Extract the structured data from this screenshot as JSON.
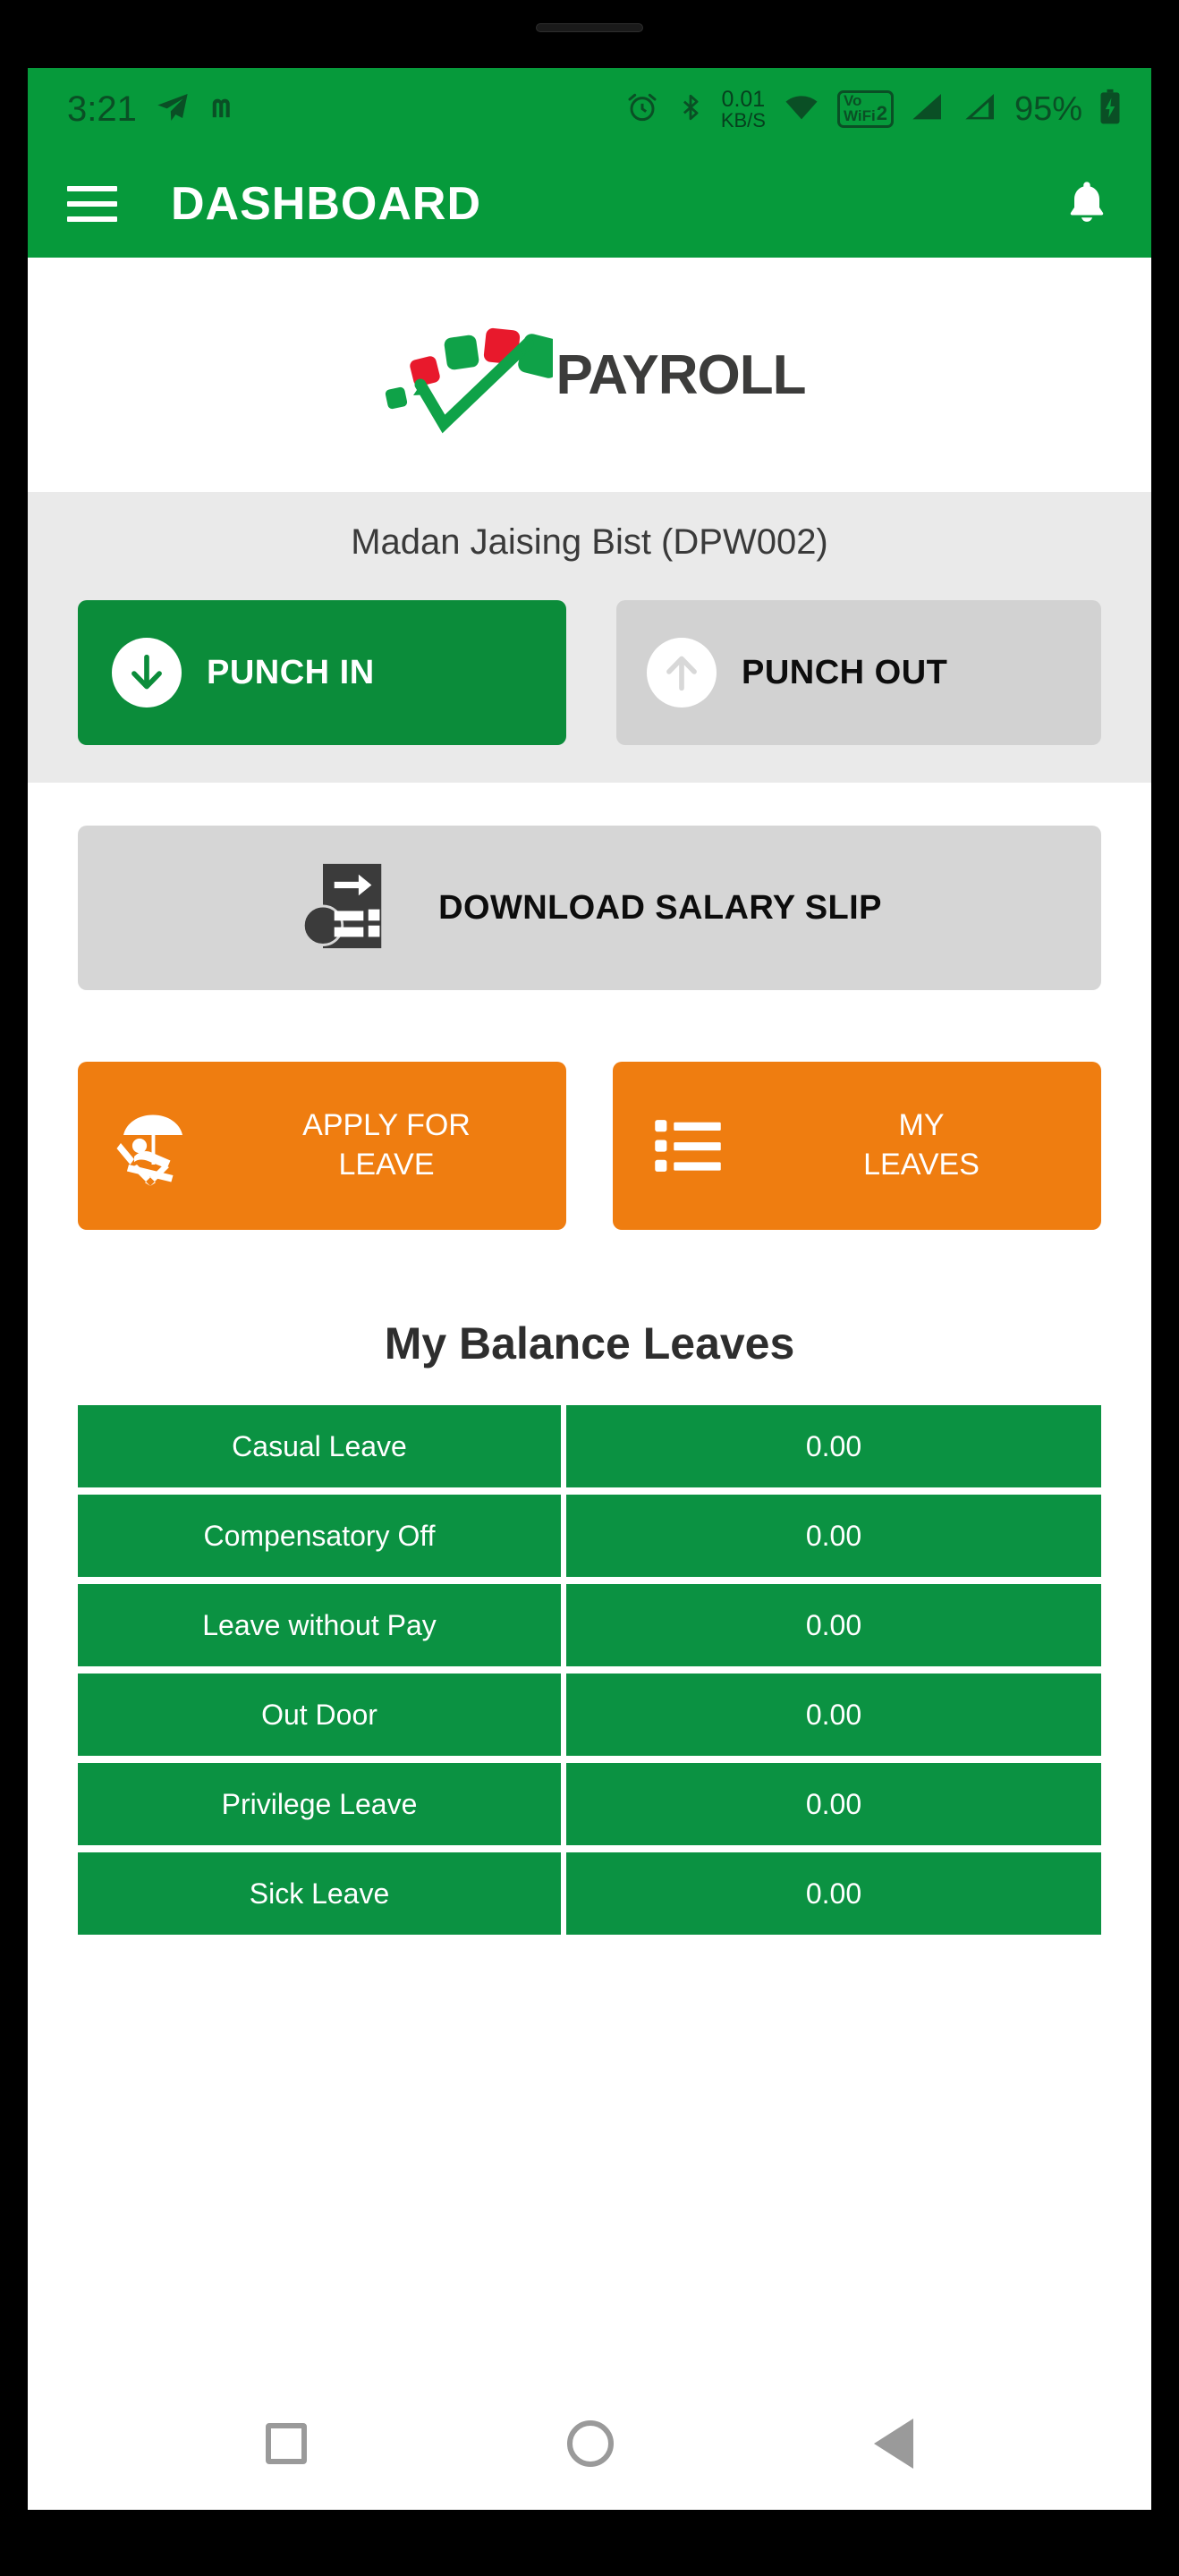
{
  "statusbar": {
    "time": "3:21",
    "telegram_icon": "send-icon",
    "m_glyph": "m",
    "alarm_icon": "alarm-clock-icon",
    "bluetooth_icon": "bluetooth-icon",
    "net_speed_value": "0.01",
    "net_speed_unit": "KB/S",
    "wifi_icon": "wifi-icon",
    "vowifi_top": "Vo",
    "vowifi_bottom": "WiFi",
    "vowifi_sim": "2",
    "signal_icon_1": "signal-bars-icon",
    "signal_icon_2": "signal-bars-icon",
    "battery_percent": "95%",
    "battery_icon": "battery-charging-icon"
  },
  "appbar": {
    "menu_icon": "hamburger-menu-icon",
    "title": "DASHBOARD",
    "bell_icon": "notification-bell-icon"
  },
  "logo": {
    "brand": "PAYROLL",
    "mark_icon": "payroll-checkmark-logo",
    "green": "#0fa248",
    "red": "#e8192c",
    "text_color": "#3c3c3b"
  },
  "employee": {
    "name_with_id": "Madan Jaising Bist (DPW002)"
  },
  "punch": {
    "in_label": "PUNCH IN",
    "in_icon": "arrow-down-circle-icon",
    "in_color": "#0b8c3a",
    "out_label": "PUNCH OUT",
    "out_icon": "arrow-up-circle-icon",
    "out_color": "#d2d2d2"
  },
  "salary_slip": {
    "label": "DOWNLOAD SALARY SLIP",
    "icon": "salary-slip-document-icon"
  },
  "leave_actions": [
    {
      "label": "APPLY FOR\nLEAVE",
      "line1": "APPLY FOR",
      "line2": "LEAVE",
      "icon": "beach-chair-umbrella-icon"
    },
    {
      "label": "MY\nLEAVES",
      "line1": "MY",
      "line2": "LEAVES",
      "icon": "list-bullets-icon"
    }
  ],
  "balance": {
    "title": "My Balance Leaves",
    "row_color": "#0b9242",
    "rows": [
      {
        "name": "Casual Leave",
        "value": "0.00"
      },
      {
        "name": "Compensatory Off",
        "value": "0.00"
      },
      {
        "name": "Leave without Pay",
        "value": "0.00"
      },
      {
        "name": "Out Door",
        "value": "0.00"
      },
      {
        "name": "Privilege Leave",
        "value": "0.00"
      },
      {
        "name": "Sick Leave",
        "value": "0.00"
      }
    ]
  },
  "navbar": {
    "recents_icon": "square-recents-icon",
    "home_icon": "circle-home-icon",
    "back_icon": "triangle-back-icon"
  }
}
